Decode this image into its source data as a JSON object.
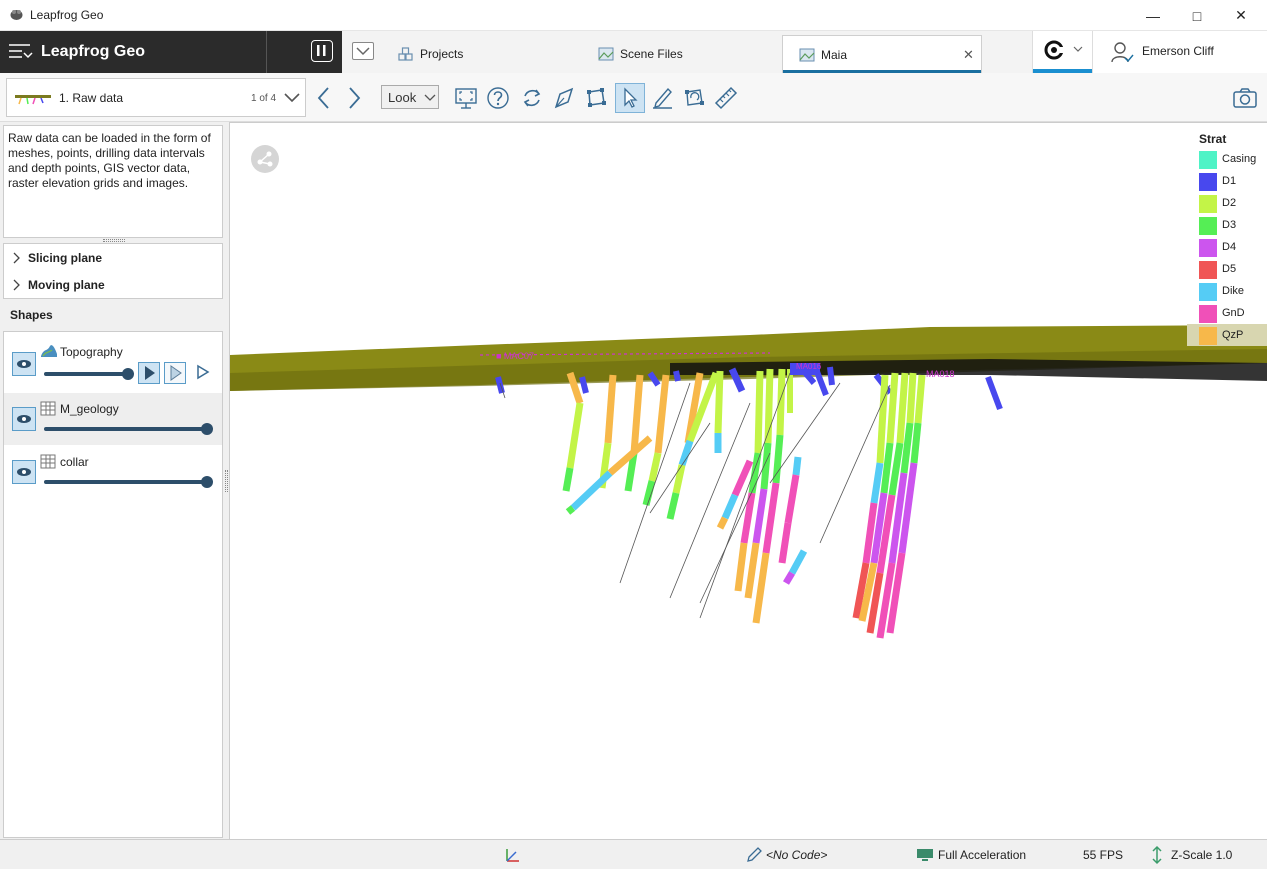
{
  "window": {
    "title": "Leapfrog Geo"
  },
  "header": {
    "brand": "Leapfrog Geo",
    "tabs": [
      {
        "label": "Projects"
      },
      {
        "label": "Scene Files"
      },
      {
        "label": "Maia"
      }
    ],
    "user": "Emerson Cliff"
  },
  "toolbar": {
    "step_name": "1. Raw data",
    "step_count": "1 of 4",
    "look_label": "Look"
  },
  "left": {
    "description": "Raw data can be loaded in the form of meshes, points, drilling data intervals and depth points, GIS vector data, raster elevation grids and images.",
    "planes": [
      "Slicing plane",
      "Moving plane"
    ],
    "shapes_header": "Shapes",
    "shapes": [
      {
        "name": "Topography",
        "opacity": 1.0
      },
      {
        "name": "M_geology",
        "opacity": 1.0
      },
      {
        "name": "collar",
        "opacity": 1.0
      }
    ]
  },
  "legend": {
    "title": "Strat",
    "items": [
      {
        "name": "Casing",
        "color": "#4ef3c6"
      },
      {
        "name": "D1",
        "color": "#4848ee"
      },
      {
        "name": "D2",
        "color": "#c3f447"
      },
      {
        "name": "D3",
        "color": "#55ee55"
      },
      {
        "name": "D4",
        "color": "#cc55ee"
      },
      {
        "name": "D5",
        "color": "#f05555"
      },
      {
        "name": "Dike",
        "color": "#55ccf5"
      },
      {
        "name": "GnD",
        "color": "#f050b8"
      },
      {
        "name": "QzP",
        "color": "#f7b84a"
      }
    ],
    "selected": "QzP"
  },
  "status": {
    "code": "<No Code>",
    "acceleration": "Full Acceleration",
    "fps": "55 FPS",
    "zscale": "Z-Scale 1.0"
  }
}
